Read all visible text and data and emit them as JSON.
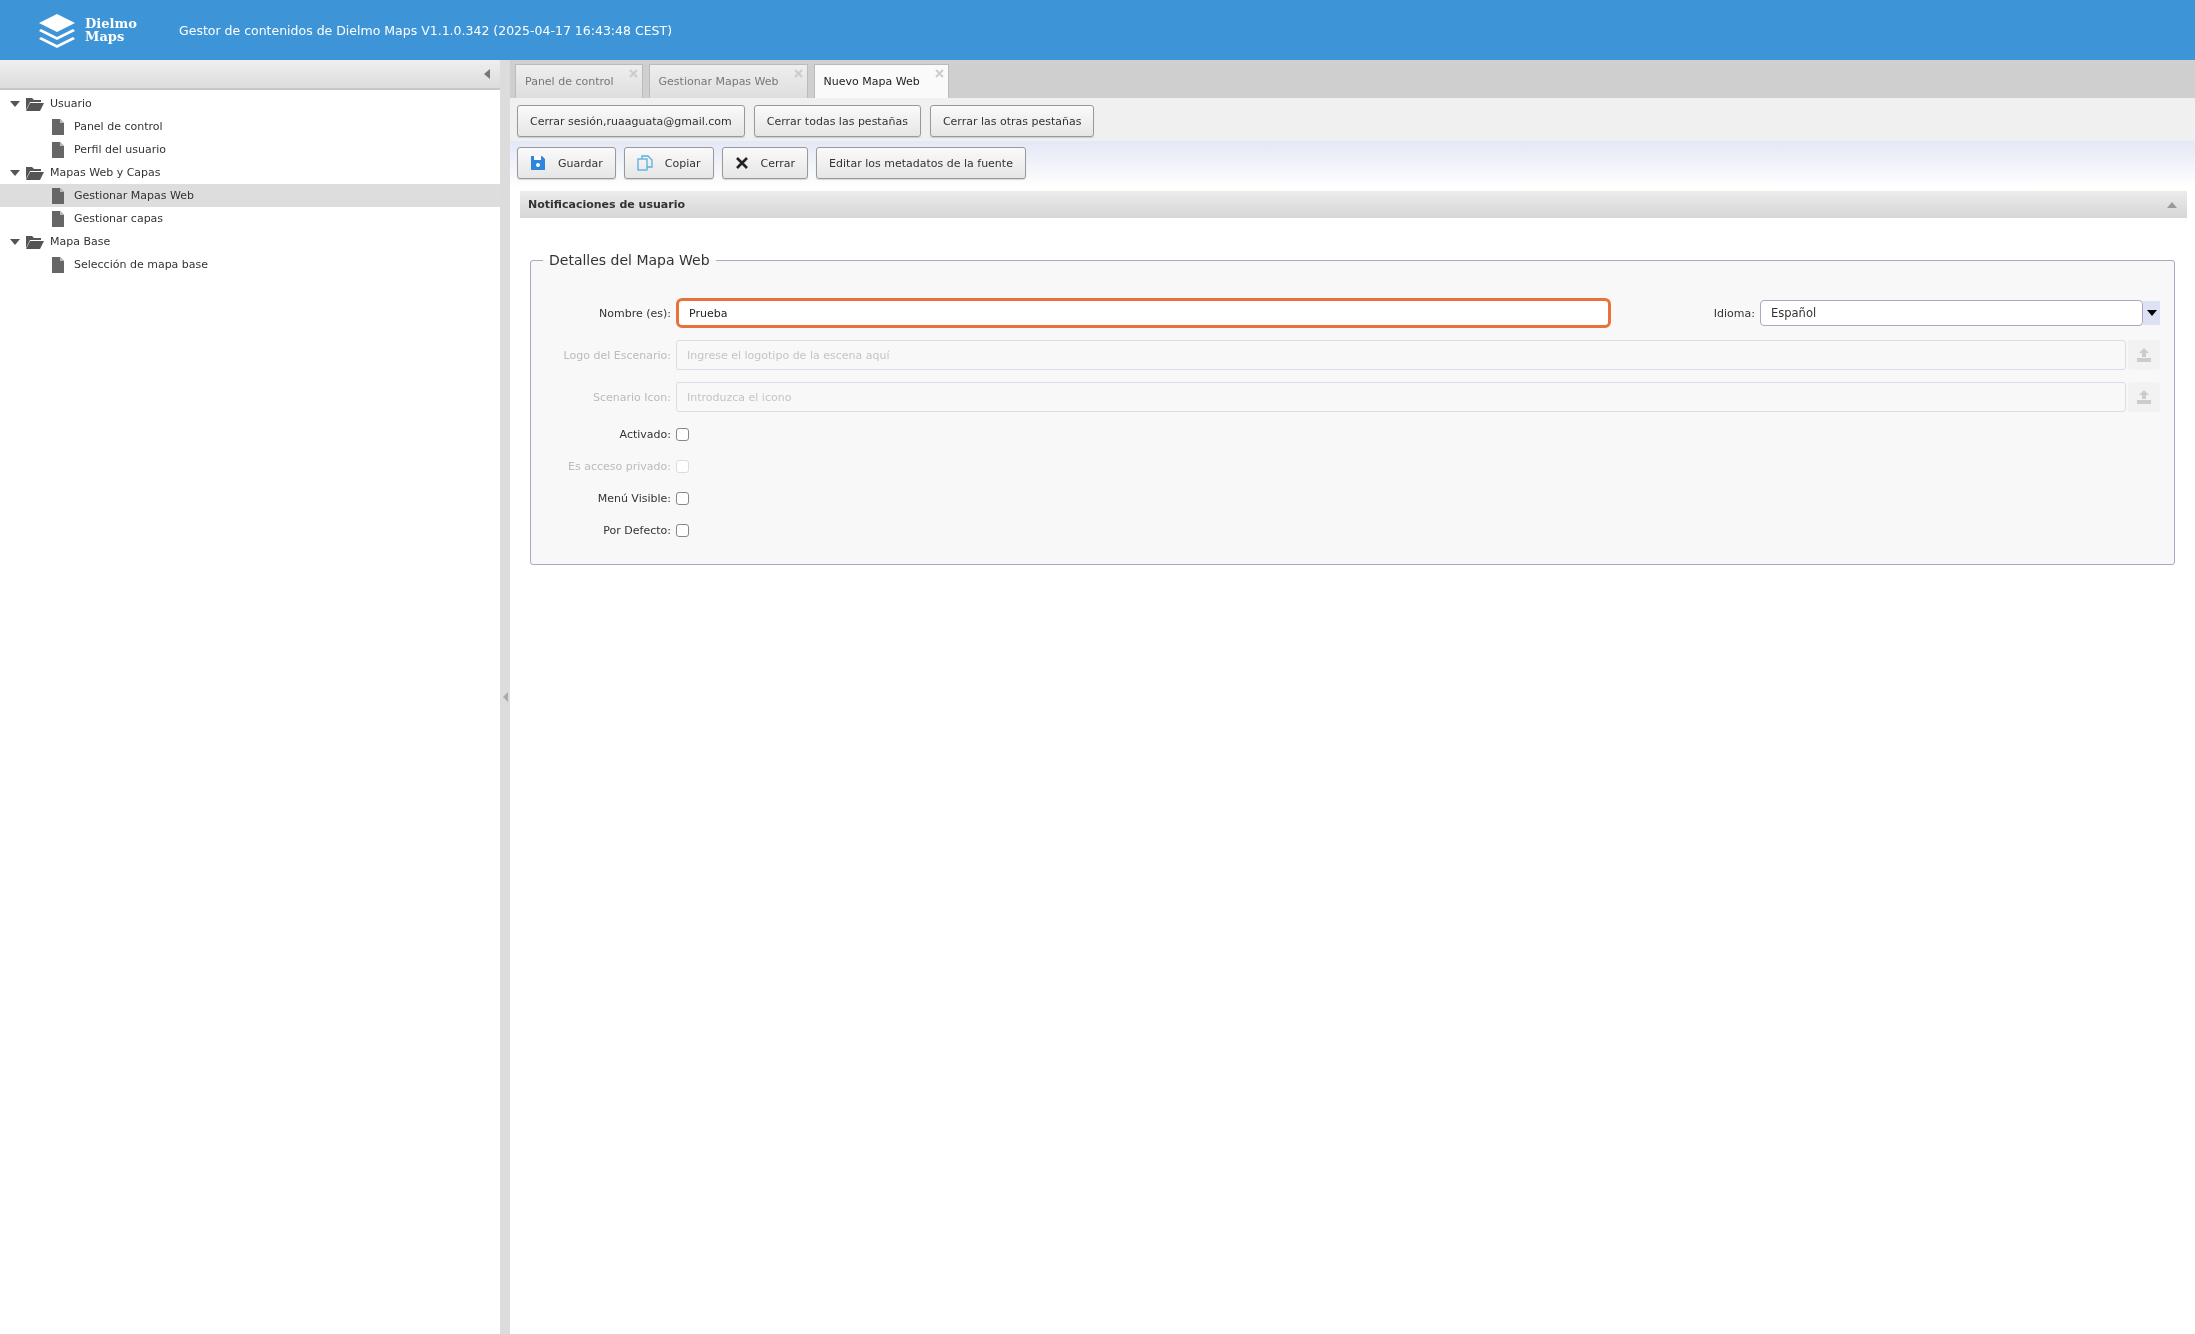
{
  "header": {
    "logo_lines": [
      "Dielmo",
      "Maps"
    ],
    "title": "Gestor de contenidos de Dielmo Maps V1.1.0.342 (2025-04-17 16:43:48 CEST)"
  },
  "sidebar": {
    "tree": [
      {
        "label": "Usuario",
        "expanded": true,
        "selected": false,
        "children": [
          {
            "label": "Panel de control",
            "selected": false
          },
          {
            "label": "Perfil del usuario",
            "selected": false
          }
        ]
      },
      {
        "label": "Mapas Web y Capas",
        "expanded": true,
        "selected": false,
        "children": [
          {
            "label": "Gestionar Mapas Web",
            "selected": true
          },
          {
            "label": "Gestionar capas",
            "selected": false
          }
        ]
      },
      {
        "label": "Mapa Base",
        "expanded": true,
        "selected": false,
        "children": [
          {
            "label": "Selección de mapa base",
            "selected": false
          }
        ]
      }
    ]
  },
  "tabs": [
    {
      "label": "Panel de control",
      "selected": false
    },
    {
      "label": "Gestionar Mapas Web",
      "selected": false
    },
    {
      "label": "Nuevo Mapa Web",
      "selected": true
    }
  ],
  "session_buttons": [
    "Cerrar sesión,ruaaguata@gmail.com",
    "Cerrar todas las pestañas",
    "Cerrar las otras pestañas"
  ],
  "toolbar": [
    {
      "kind": "save",
      "label": "Guardar"
    },
    {
      "kind": "copy",
      "label": "Copiar"
    },
    {
      "kind": "close",
      "label": "Cerrar"
    },
    {
      "kind": "plain",
      "label": "Editar los metadatos de la fuente"
    }
  ],
  "notifications": {
    "title": "Notificaciones de usuario",
    "expanded": true
  },
  "form": {
    "legend": "Detalles del Mapa Web",
    "name": {
      "label": "Nombre (es):",
      "value": "Prueba",
      "focused": true
    },
    "language": {
      "label": "Idioma:",
      "value": "Español"
    },
    "fields": [
      {
        "kind": "upload",
        "label": "Logo del Escenario:",
        "placeholder": "Ingrese el logotipo de la escena aquí",
        "disabled": true
      },
      {
        "kind": "upload",
        "label": "Scenario Icon:",
        "placeholder": "Introduzca el icono",
        "disabled": true
      },
      {
        "kind": "checkbox",
        "label": "Activado:",
        "checked": false,
        "disabled": false
      },
      {
        "kind": "checkbox",
        "label": "Es acceso privado:",
        "checked": false,
        "disabled": true
      },
      {
        "kind": "checkbox",
        "label": "Menú Visible:",
        "checked": false,
        "disabled": false
      },
      {
        "kind": "checkbox",
        "label": "Por Defecto:",
        "checked": false,
        "disabled": false
      }
    ]
  }
}
